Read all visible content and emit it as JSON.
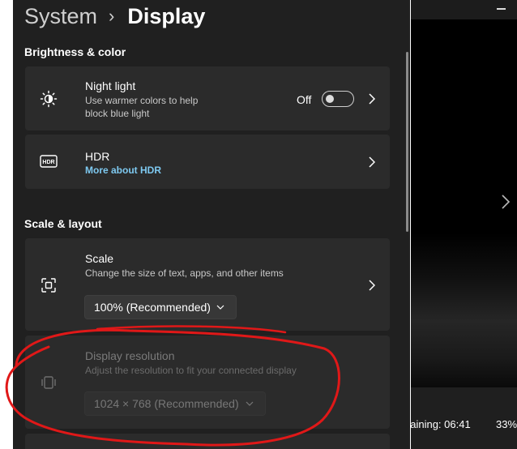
{
  "breadcrumb": {
    "parent": "System",
    "separator": "›",
    "current": "Display"
  },
  "sections": {
    "brightness_color": "Brightness & color",
    "scale_layout": "Scale & layout"
  },
  "night_light": {
    "title": "Night light",
    "desc_line1": "Use warmer colors to help",
    "desc_line2": "block blue light",
    "toggle_state": "Off",
    "icon": "brightness-sun-icon"
  },
  "hdr": {
    "title": "HDR",
    "link": "More about HDR",
    "icon": "hdr-icon"
  },
  "scale": {
    "title": "Scale",
    "desc": "Change the size of text, apps, and other items",
    "value": "100% (Recommended)",
    "icon": "scale-icon"
  },
  "resolution": {
    "title": "Display resolution",
    "desc": "Adjust the resolution to fit your connected display",
    "value": "1024 × 768 (Recommended)",
    "icon": "resolution-icon"
  },
  "video_player": {
    "status": "naining: 06:41",
    "percent": "33%"
  },
  "colors": {
    "background": "#202020",
    "card": "#2b2b2b",
    "link": "#7ec9f0",
    "annotation": "#e01818"
  }
}
